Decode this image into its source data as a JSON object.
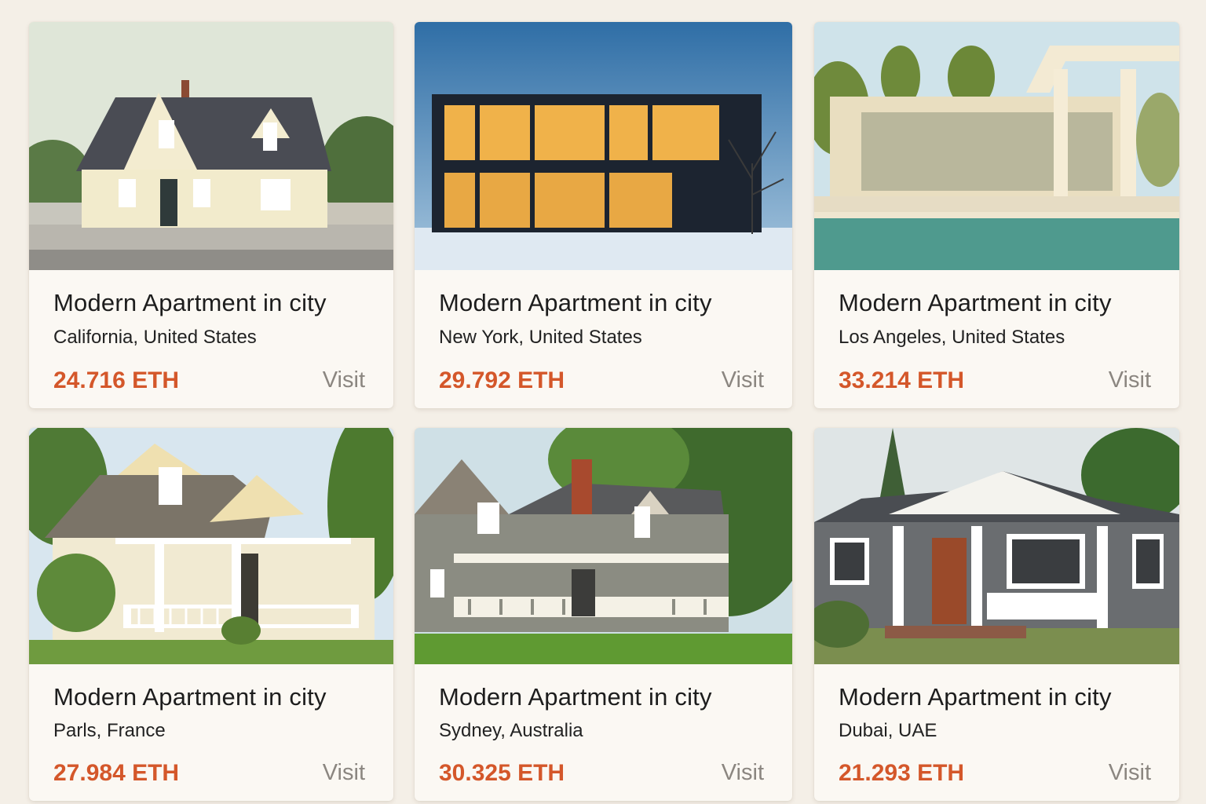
{
  "listings": [
    {
      "title": "Modern Apartment in city",
      "location": "California, United States",
      "price": "24.716 ETH",
      "cta": "Visit",
      "photo_icon": "cottage-house-photo"
    },
    {
      "title": "Modern Apartment in city",
      "location": "New York, United States",
      "price": "29.792 ETH",
      "cta": "Visit",
      "photo_icon": "modern-glass-house-photo"
    },
    {
      "title": "Modern Apartment in city",
      "location": "Los Angeles, United States",
      "price": "33.214 ETH",
      "cta": "Visit",
      "photo_icon": "pool-villa-photo"
    },
    {
      "title": "Modern Apartment in city",
      "location": "Parls, France",
      "price": "27.984 ETH",
      "cta": "Visit",
      "photo_icon": "porch-house-photo"
    },
    {
      "title": "Modern Apartment in city",
      "location": "Sydney, Australia",
      "price": "30.325 ETH",
      "cta": "Visit",
      "photo_icon": "farmhouse-photo"
    },
    {
      "title": "Modern Apartment in city",
      "location": "Dubai, UAE",
      "price": "21.293 ETH",
      "cta": "Visit",
      "photo_icon": "bungalow-photo"
    }
  ],
  "colors": {
    "price": "#d4572a",
    "visit": "#8b8680",
    "card": "#fbf8f3",
    "background": "#f4efe7"
  }
}
